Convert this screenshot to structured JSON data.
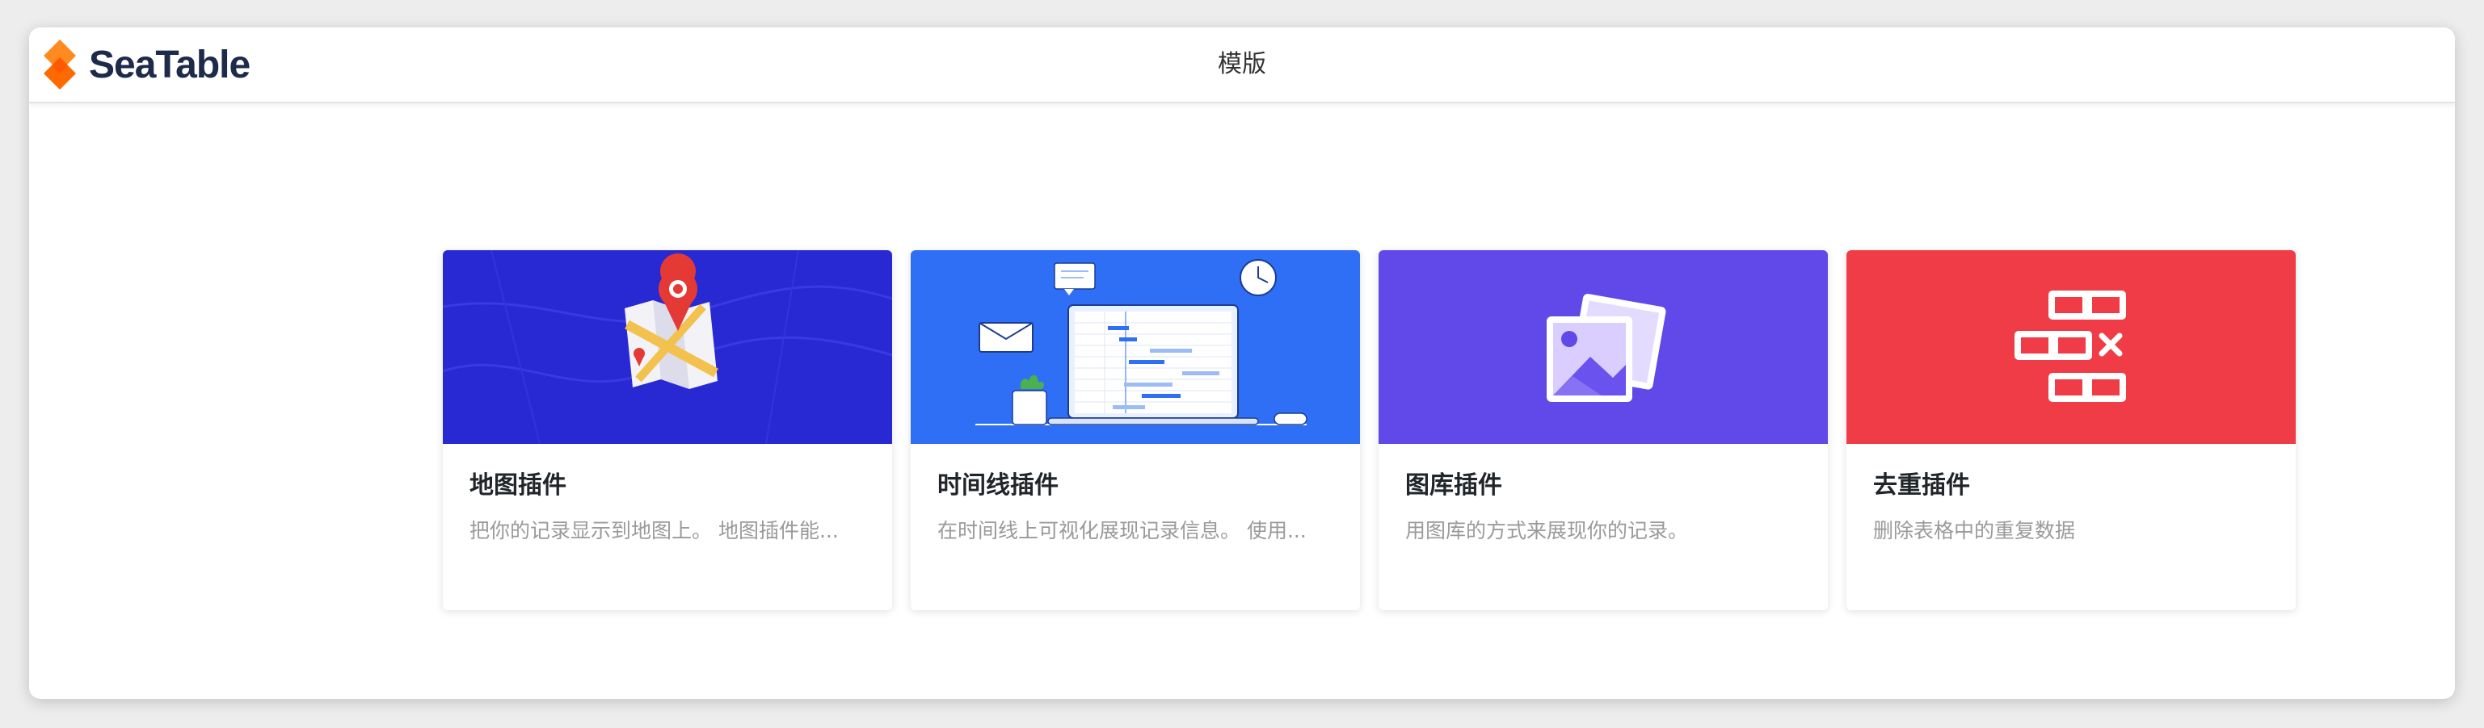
{
  "app": {
    "logo_text": "SeaTable",
    "page_title": "模版"
  },
  "colors": {
    "map_banner": "#2929d4",
    "timeline_banner": "#2f6ff6",
    "gallery_banner": "#6148e8",
    "dedupe_banner": "#ef3c47",
    "logo_orange": "#ff7a1a"
  },
  "cards": [
    {
      "title": "地图插件",
      "description": "把你的记录显示到地图上。 地图插件能...",
      "icon": "map-pin-icon"
    },
    {
      "title": "时间线插件",
      "description": "在时间线上可视化展现记录信息。 使用...",
      "icon": "timeline-laptop-icon"
    },
    {
      "title": "图库插件",
      "description": "用图库的方式来展现你的记录。",
      "icon": "gallery-icon"
    },
    {
      "title": "去重插件",
      "description": "删除表格中的重复数据",
      "icon": "deduplicate-icon"
    }
  ]
}
